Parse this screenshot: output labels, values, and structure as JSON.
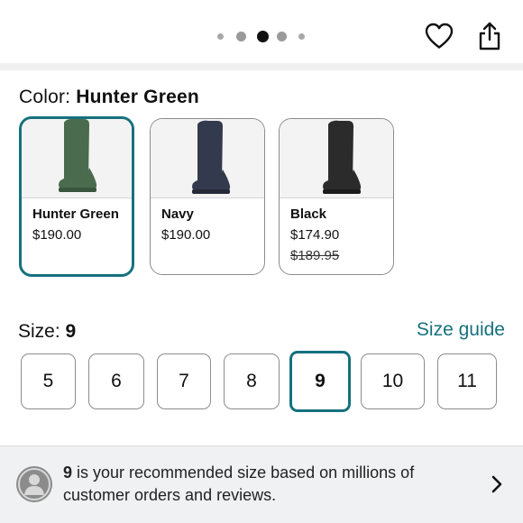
{
  "header": {
    "carousel_page_count": 5,
    "carousel_active_index": 2,
    "favorite_icon": "heart-outline-icon",
    "share_icon": "share-icon"
  },
  "color": {
    "label": "Color:",
    "selected": "Hunter Green",
    "options": [
      {
        "name": "Hunter Green",
        "price": "$190.00",
        "old_price": "",
        "boot_color": "#4a6b4e",
        "selected": true
      },
      {
        "name": "Navy",
        "price": "$190.00",
        "old_price": "",
        "boot_color": "#343a4d",
        "selected": false
      },
      {
        "name": "Black",
        "price": "$174.90",
        "old_price": "$189.95",
        "boot_color": "#2b2b2b",
        "selected": false
      }
    ]
  },
  "size": {
    "label": "Size:",
    "selected": "9",
    "guide_label": "Size guide",
    "options": [
      "5",
      "6",
      "7",
      "8",
      "9",
      "10",
      "11"
    ]
  },
  "recommendation": {
    "size": "9",
    "text": " is your recommended size based on millions of customer orders and reviews."
  },
  "colors": {
    "accent": "#16717e",
    "border": "#8c8c8c",
    "banner_bg": "#f0f1f2"
  }
}
